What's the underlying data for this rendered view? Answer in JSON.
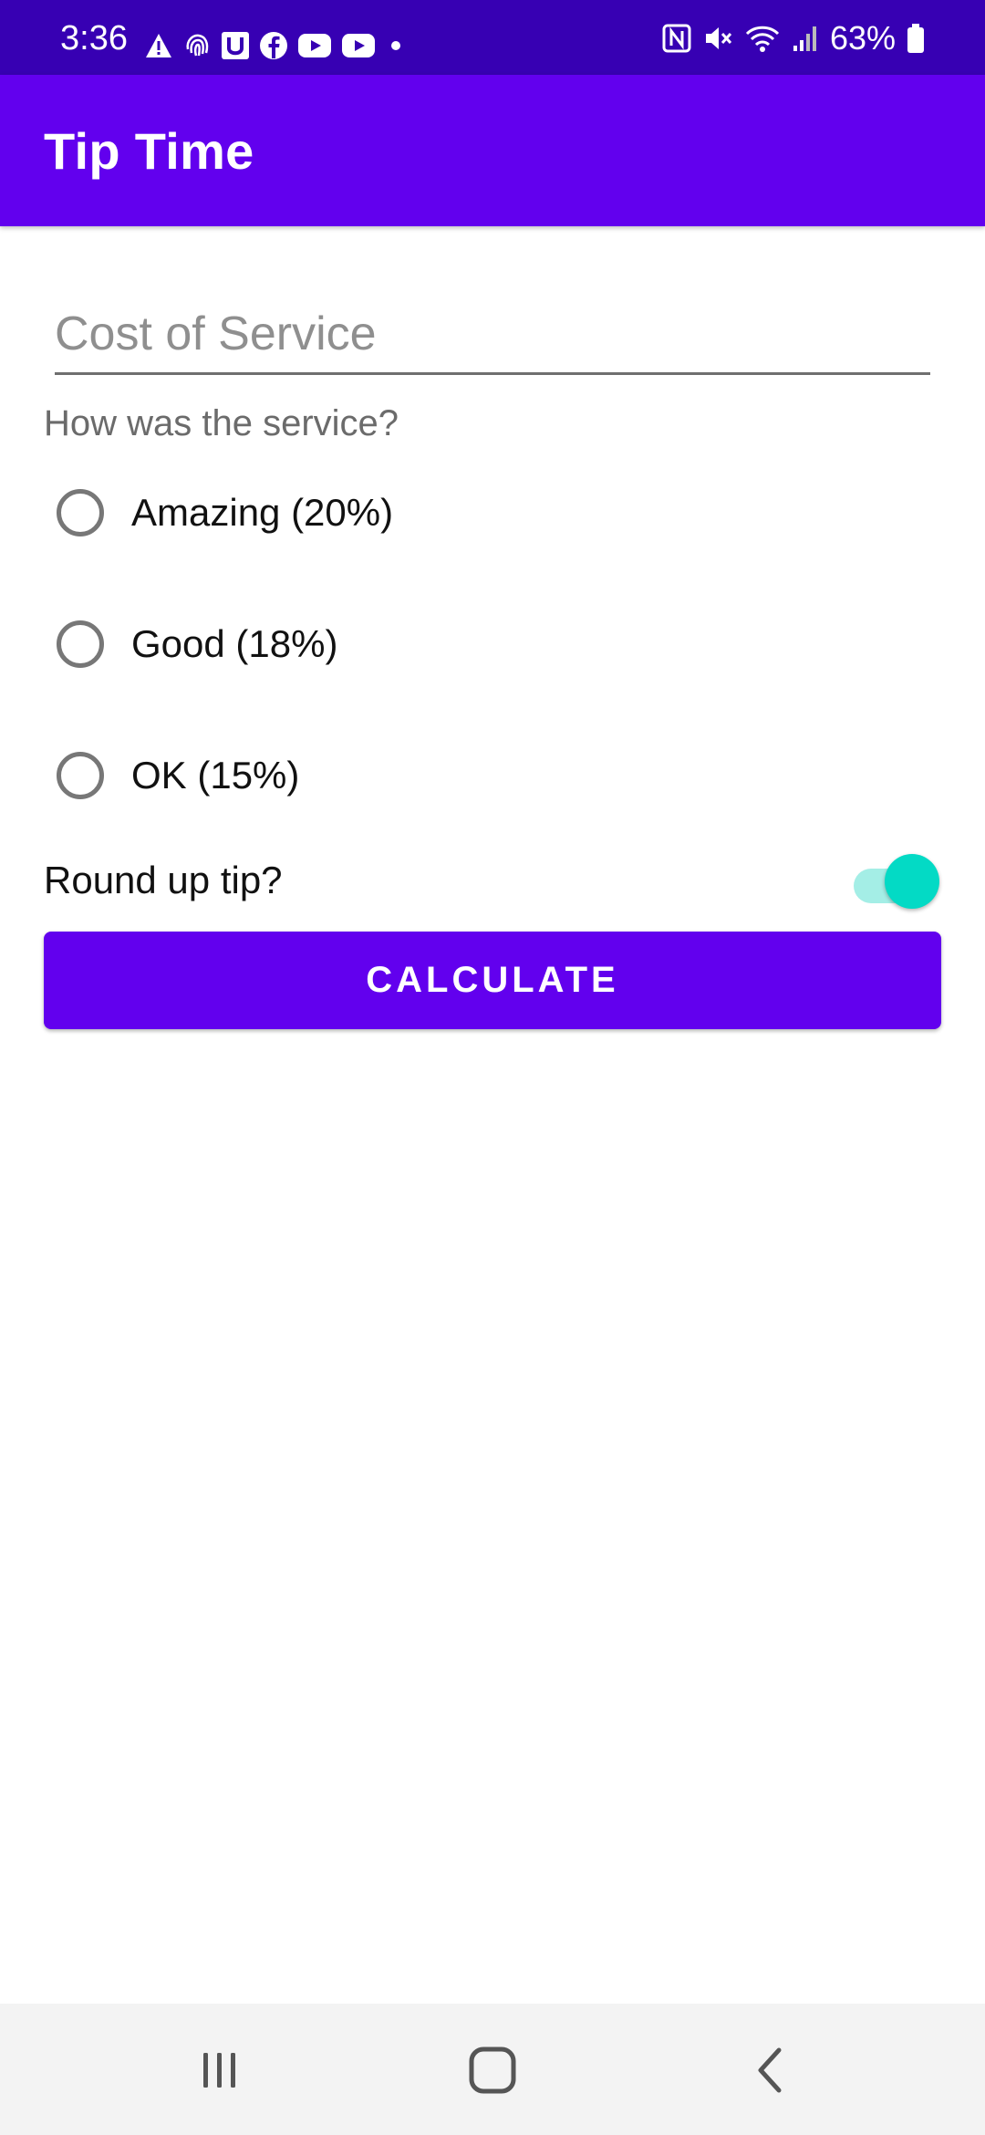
{
  "status_bar": {
    "time": "3:36",
    "battery": "63%",
    "left_icons": [
      "warning-icon",
      "fingerprint-icon",
      "u-app-icon",
      "facebook-icon",
      "youtube-icon",
      "youtube-icon",
      "dot-icon"
    ],
    "right_icons": [
      "nfc-icon",
      "mute-icon",
      "wifi-icon",
      "signal-icon",
      "battery-icon"
    ]
  },
  "app_bar": {
    "title": "Tip Time"
  },
  "form": {
    "cost_placeholder": "Cost of Service",
    "question": "How was the service?",
    "options": [
      {
        "label": "Amazing (20%)",
        "selected": false
      },
      {
        "label": "Good (18%)",
        "selected": false
      },
      {
        "label": "OK (15%)",
        "selected": false
      }
    ],
    "round_up_label": "Round up tip?",
    "round_up_on": true,
    "calculate_label": "CALCULATE"
  },
  "colors": {
    "primary": "#6200ee",
    "primary_dark": "#3700b3",
    "accent": "#03dac5"
  },
  "nav_bar": {
    "buttons": [
      "recent-apps-icon",
      "home-icon",
      "back-icon"
    ]
  }
}
